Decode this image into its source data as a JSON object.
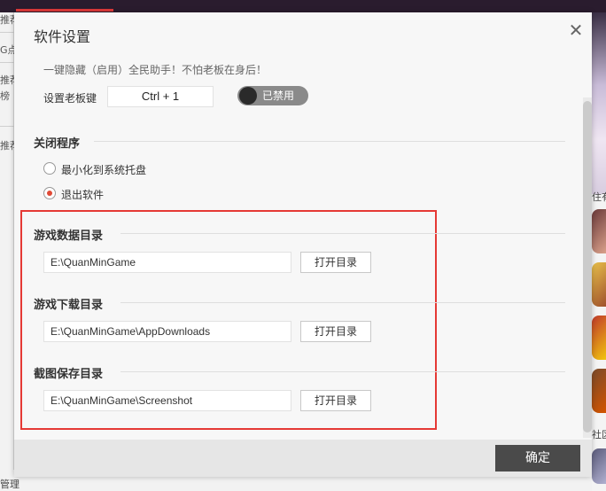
{
  "background": {
    "left_labels": [
      "推荐",
      "G点",
      "推荐",
      "榜",
      "推荐"
    ],
    "right_labels": [
      "住有",
      "社区"
    ],
    "bottom_label": "管理"
  },
  "dialog": {
    "title": "软件设置",
    "tip": "一键隐藏（启用）全民助手！不怕老板在身后！",
    "boss_key": {
      "label": "设置老板键",
      "value": "Ctrl + 1",
      "toggle_label": "已禁用"
    },
    "close_program": {
      "title": "关闭程序",
      "options": [
        {
          "label": "最小化到系统托盘",
          "selected": false
        },
        {
          "label": "退出软件",
          "selected": true
        }
      ]
    },
    "directories": [
      {
        "title": "游戏数据目录",
        "path": "E:\\QuanMinGame",
        "button": "打开目录"
      },
      {
        "title": "游戏下载目录",
        "path": "E:\\QuanMinGame\\AppDownloads",
        "button": "打开目录"
      },
      {
        "title": "截图保存目录",
        "path": "E:\\QuanMinGame\\Screenshot",
        "button": "打开目录"
      }
    ],
    "confirm_button": "确定"
  },
  "colors": {
    "accent": "#e04a36",
    "highlight_box": "#e53935",
    "confirm_bg": "#4a4a4a"
  },
  "icons": {
    "close": "close-icon"
  }
}
